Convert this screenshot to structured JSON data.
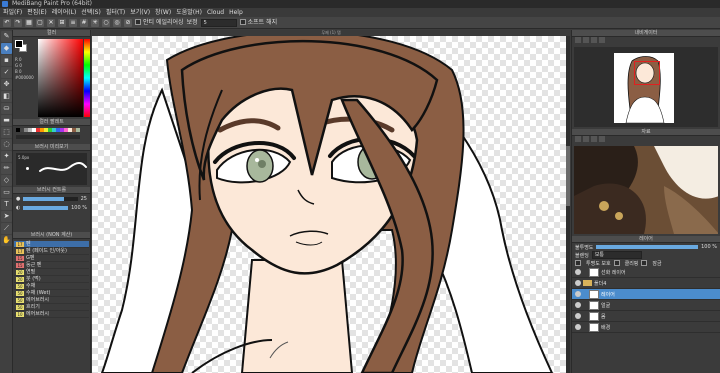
{
  "titlebar": {
    "title": "MediBang Paint Pro (64bit)"
  },
  "menu": [
    "파일(F)",
    "편집(E)",
    "레이어(L)",
    "선택(S)",
    "필터(T)",
    "보기(V)",
    "창(W)",
    "도움말(H)",
    "Cloud",
    "Help"
  ],
  "toolbar": {
    "antialias_label": "안티 에일리어싱",
    "correction_label": "보정",
    "correction_value": "5",
    "soft_delete_label": "소프트 해지"
  },
  "canvas": {
    "tab_title": "무제 (1) 탭"
  },
  "color_panel": {
    "title": "컬러",
    "r": "R 0",
    "g": "G 0",
    "b": "B 0",
    "hex": "#000000"
  },
  "palette_panel": {
    "title": "컬러 팔레트"
  },
  "brush_panel": {
    "title": "브러시 미리보기",
    "size_label": "5.0px"
  },
  "brush_control": {
    "title": "브러시 컨트롤",
    "size_value": "25",
    "opacity_value": "100 %",
    "size": 0.75,
    "opacity": 1.0
  },
  "brush_list": {
    "title": "브러시 (NON 계산)",
    "items": [
      {
        "num": "17",
        "name": "펜",
        "color": "#e8c25a"
      },
      {
        "num": "17",
        "name": "펜 (페이드 인/아웃)",
        "color": "#e8c25a"
      },
      {
        "num": "15",
        "name": "G펜",
        "color": "#e07070"
      },
      {
        "num": "15",
        "name": "둥근 펜",
        "color": "#e07070"
      },
      {
        "num": "20",
        "name": "연필",
        "color": "#e8e070"
      },
      {
        "num": "20",
        "name": "붓 (먹)",
        "color": "#e8e070"
      },
      {
        "num": "50",
        "name": "수채",
        "color": "#e8e070"
      },
      {
        "num": "50",
        "name": "수채 (Wet)",
        "color": "#e8e070"
      },
      {
        "num": "50",
        "name": "에어브러시",
        "color": "#e8e070"
      },
      {
        "num": "50",
        "name": "흐리기",
        "color": "#e8e070"
      },
      {
        "num": "10",
        "name": "에어브러시",
        "color": "#e8e070"
      }
    ]
  },
  "navigator": {
    "title": "내비게이터"
  },
  "reference": {
    "title": "자료"
  },
  "layers": {
    "title": "레이어",
    "opacity_label": "불투명도",
    "opacity_value": "100 %",
    "opacity": 1.0,
    "blend_label": "블렌딩",
    "blend_value": "보통",
    "protect_label": "투명도 보호",
    "clip_label": "클리핑",
    "lock_label": "잠금",
    "items": [
      {
        "name": "선화 레이어",
        "type": "layer",
        "selected": false
      },
      {
        "name": "폴더4",
        "type": "folder",
        "selected": false
      },
      {
        "name": "레이어",
        "type": "layer",
        "selected": true
      },
      {
        "name": "얼굴",
        "type": "layer",
        "selected": false
      },
      {
        "name": "몸",
        "type": "layer",
        "selected": false
      },
      {
        "name": "배경",
        "type": "layer",
        "selected": false
      }
    ]
  },
  "colors": {
    "accent": "#4b8ccc",
    "hair": "#8b5e44",
    "skin": "#fce8d8",
    "eyes": "#a8b89c"
  }
}
